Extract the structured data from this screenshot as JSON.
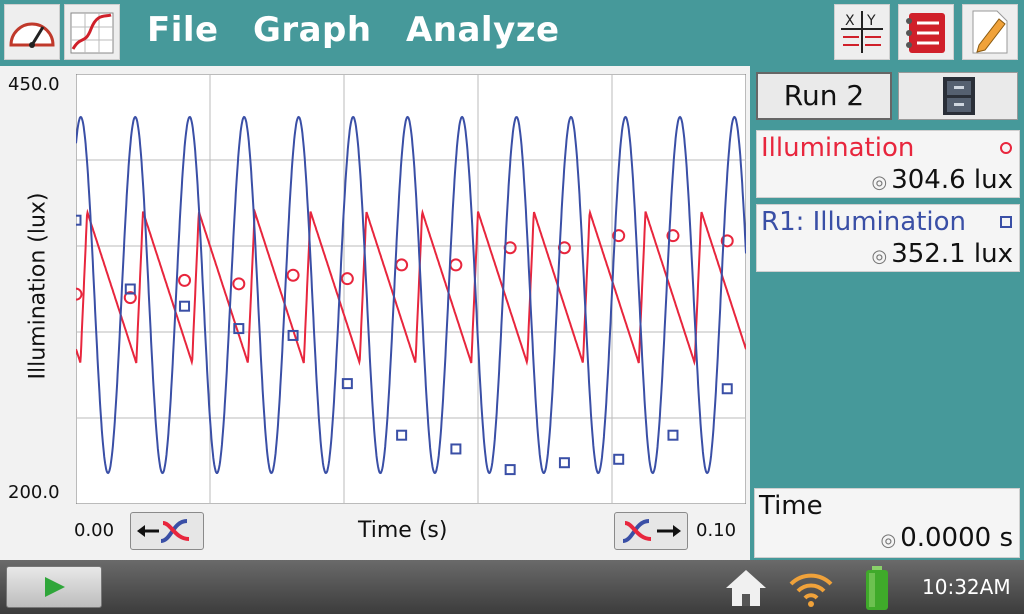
{
  "menu": {
    "file": "File",
    "graph": "Graph",
    "analyze": "Analyze"
  },
  "toolbar": {
    "left_icons": [
      "meter-icon",
      "graph-icon"
    ],
    "right_icons": [
      "table-icon",
      "list-icon",
      "notes-icon"
    ]
  },
  "graph": {
    "y_axis_label": "Illumination (lux)",
    "y_max_label": "450.0",
    "y_min_label": "200.0",
    "x_axis_label": "Time (s)",
    "x_min_label": "0.00",
    "x_max_label": "0.10"
  },
  "run": {
    "label": "Run 2"
  },
  "meters": [
    {
      "name": "Illumination",
      "value": "304.6 lux",
      "color": "#e8263d",
      "marker": "circle"
    },
    {
      "name": "R1: Illumination",
      "value": "352.1 lux",
      "color": "#3a4fa6",
      "marker": "square"
    }
  ],
  "time_meter": {
    "name": "Time",
    "value": "0.0000 s"
  },
  "status": {
    "clock": "10:32AM"
  },
  "colors": {
    "teal": "#46999a",
    "red_series": "#e8263d",
    "blue_series": "#3a4fa6"
  },
  "chart_data": {
    "type": "line",
    "xlabel": "Time (s)",
    "ylabel": "Illumination (lux)",
    "xlim": [
      0.0,
      0.1
    ],
    "ylim": [
      200.0,
      450.0
    ],
    "grid": true,
    "series": [
      {
        "name": "Illumination",
        "color": "#e8263d",
        "marker": "circle",
        "shape": "sawtooth",
        "periods": 12,
        "min": 282,
        "max": 370,
        "x": [
          0.0,
          0.0081,
          0.0162,
          0.0243,
          0.0324,
          0.0405,
          0.0486,
          0.0567,
          0.0648,
          0.0729,
          0.081,
          0.0891,
          0.0972
        ],
        "y": [
          322,
          320,
          330,
          328,
          333,
          331,
          339,
          339,
          349,
          349,
          356,
          356,
          353
        ]
      },
      {
        "name": "R1: Illumination",
        "color": "#3a4fa6",
        "marker": "square",
        "shape": "sine",
        "periods": 12.3,
        "min": 218,
        "max": 425,
        "x": [
          0.0,
          0.0081,
          0.0162,
          0.0243,
          0.0324,
          0.0405,
          0.0486,
          0.0567,
          0.0648,
          0.0729,
          0.081,
          0.0891,
          0.0972
        ],
        "y": [
          365,
          325,
          315,
          302,
          298,
          270,
          240,
          232,
          220,
          224,
          226,
          240,
          267
        ]
      }
    ]
  }
}
